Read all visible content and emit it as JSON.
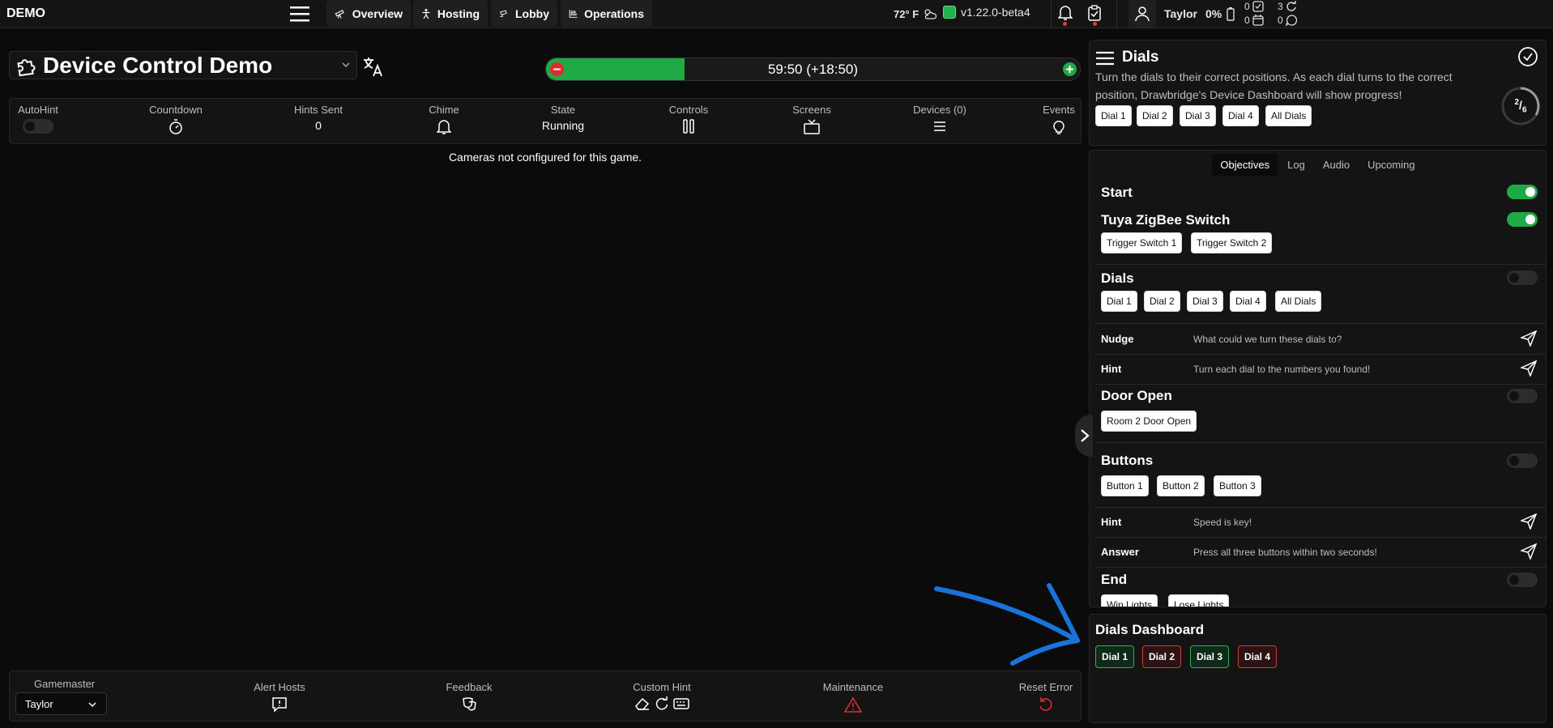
{
  "topbar": {
    "brand": "DEMO",
    "nav": [
      {
        "label": "Overview",
        "icon": "telescope-icon"
      },
      {
        "label": "Hosting",
        "icon": "person-icon"
      },
      {
        "label": "Lobby",
        "icon": "camera-icon"
      },
      {
        "label": "Operations",
        "icon": "chart-icon"
      }
    ],
    "temperature": "72° F",
    "version": "v1.22.0-beta4",
    "user": "Taylor",
    "battery": "0%",
    "counts": {
      "tasks": "0",
      "calendar": "0",
      "refresh": "3",
      "chat": "0"
    }
  },
  "game": {
    "title": "Device Control Demo",
    "timer_text": "59:50 (+18:50)",
    "timer_progress": 0.26,
    "cameras_message": "Cameras not configured for this game."
  },
  "stats": {
    "autohint": {
      "label": "AutoHint",
      "on": false
    },
    "countdown": {
      "label": "Countdown"
    },
    "hints_sent": {
      "label": "Hints Sent",
      "value": "0"
    },
    "chime": {
      "label": "Chime"
    },
    "state": {
      "label": "State",
      "value": "Running"
    },
    "controls": {
      "label": "Controls"
    },
    "screens": {
      "label": "Screens"
    },
    "devices": {
      "label": "Devices (0)"
    },
    "events": {
      "label": "Events"
    }
  },
  "bottombar": {
    "gamemaster_label": "Gamemaster",
    "gamemaster_value": "Taylor",
    "alert_hosts": "Alert Hosts",
    "feedback": "Feedback",
    "custom_hint": "Custom Hint",
    "maintenance": "Maintenance",
    "reset_error": "Reset Error"
  },
  "dials_header": {
    "title": "Dials",
    "description": "Turn the dials to their correct positions. As each dial turns to the correct position, Drawbridge's Device Dashboard will show progress!",
    "chips": [
      "Dial 1",
      "Dial 2",
      "Dial 3",
      "Dial 4",
      "All Dials"
    ],
    "progress_num": "2",
    "progress_den": "6",
    "progress_fraction": 0.333
  },
  "objectives": {
    "tabs": [
      "Objectives",
      "Log",
      "Audio",
      "Upcoming"
    ],
    "start": {
      "title": "Start",
      "on": true
    },
    "tuya": {
      "title": "Tuya ZigBee Switch",
      "on": true,
      "chips": [
        "Trigger Switch 1",
        "Trigger Switch 2"
      ]
    },
    "dials": {
      "title": "Dials",
      "on": false,
      "chips": [
        "Dial 1",
        "Dial 2",
        "Dial 3",
        "Dial 4",
        "All Dials"
      ],
      "nudge_label": "Nudge",
      "nudge_text": "What could we turn these dials to?",
      "hint_label": "Hint",
      "hint_text": "Turn each dial to the numbers you found!"
    },
    "door": {
      "title": "Door Open",
      "on": false,
      "chips": [
        "Room 2 Door Open"
      ]
    },
    "buttons": {
      "title": "Buttons",
      "on": false,
      "chips": [
        "Button 1",
        "Button 2",
        "Button 3"
      ],
      "hint_label": "Hint",
      "hint_text": "Speed is key!",
      "answer_label": "Answer",
      "answer_text": "Press all three buttons within two seconds!"
    },
    "end": {
      "title": "End",
      "on": false,
      "chips": [
        "Win Lights",
        "Lose Lights"
      ]
    }
  },
  "dashboard": {
    "title": "Dials Dashboard",
    "dials": [
      {
        "label": "Dial 1",
        "status": "green"
      },
      {
        "label": "Dial 2",
        "status": "red"
      },
      {
        "label": "Dial 3",
        "status": "green"
      },
      {
        "label": "Dial 4",
        "status": "red"
      }
    ]
  },
  "colors": {
    "accent_green": "#1faa47",
    "alert_red": "#e02b2b",
    "annotation_blue": "#1a73d9"
  }
}
